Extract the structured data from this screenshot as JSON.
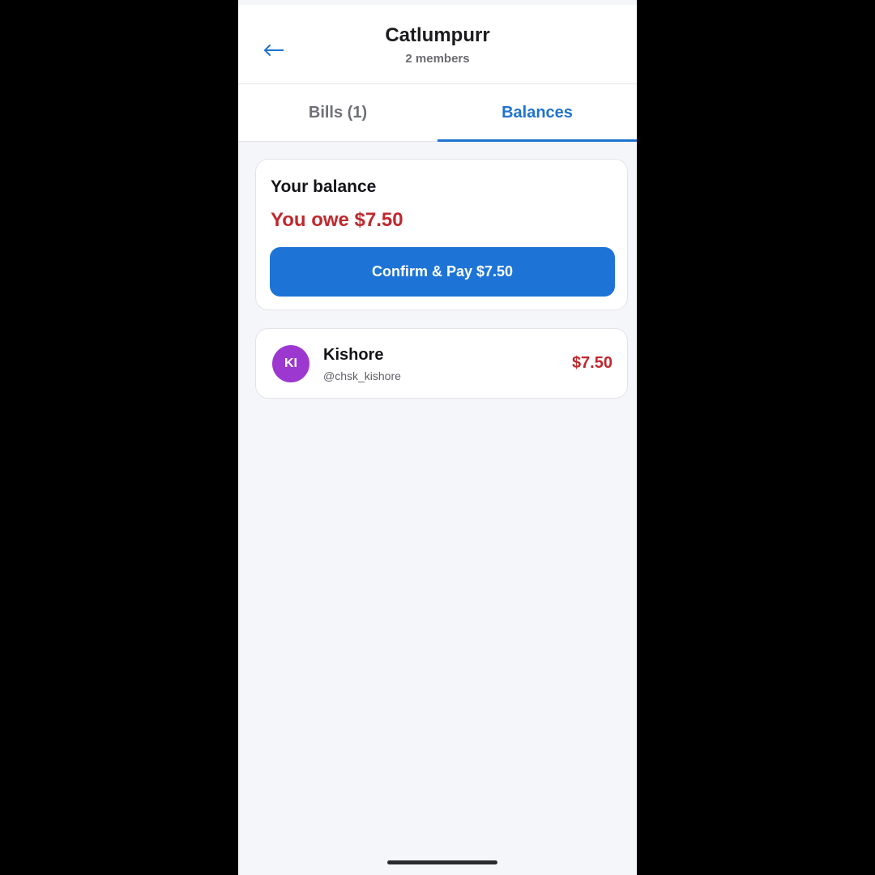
{
  "header": {
    "back_icon": "arrow-left-icon",
    "title": "Catlumpurr",
    "subtitle": "2 members"
  },
  "tabs": [
    {
      "label": "Bills (1)",
      "active": false
    },
    {
      "label": "Balances",
      "active": true
    }
  ],
  "balance_card": {
    "heading": "Your balance",
    "status": "You owe $7.50",
    "pay_button_label": "Confirm & Pay $7.50"
  },
  "members": [
    {
      "initials": "KI",
      "name": "Kishore",
      "handle": "@chsk_kishore",
      "amount": "$7.50"
    }
  ],
  "colors": {
    "accent": "#1f73cf",
    "button": "#1d74d6",
    "owe": "#c0282d",
    "avatar": "#9c37cf",
    "background": "#f5f6fa"
  }
}
